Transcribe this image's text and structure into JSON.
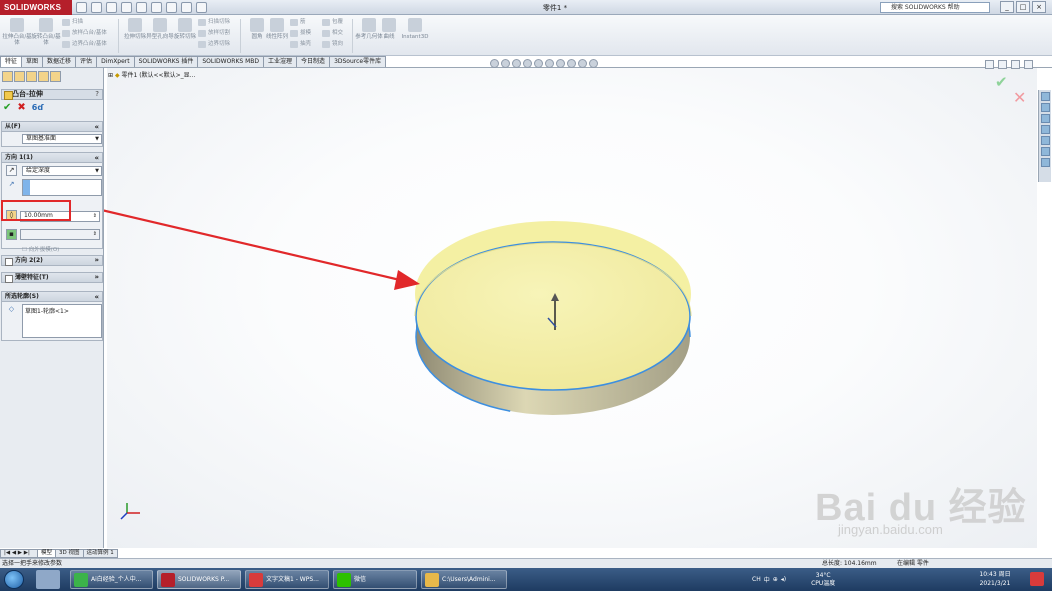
{
  "window": {
    "app_logo": "SOLIDWORKS",
    "doc_title": "零件1 *",
    "help_search": "搜索 SOLIDWORKS 帮助",
    "controls": [
      "_",
      "□",
      "×"
    ]
  },
  "command_manager": {
    "large_buttons": [
      "拉伸凸台/基体",
      "旋转凸台/基体",
      "拉伸切除",
      "异型孔向导",
      "旋转切除",
      "圆角",
      "线性阵列",
      "参考几何体",
      "曲线",
      "Instant3D"
    ],
    "small_rows": [
      "扫描",
      "放样凸台/基体",
      "边界凸台/基体",
      "扫描切除",
      "放样切割",
      "边界切除",
      "筋",
      "拔模",
      "抽壳",
      "包覆",
      "相交",
      "镜向"
    ]
  },
  "tabs": [
    "特征",
    "草图",
    "数据迁移",
    "评估",
    "DimXpert",
    "SOLIDWORKS 插件",
    "SOLIDWORKS MBD",
    "工业渲理",
    "今日制造",
    "3DSource零件库"
  ],
  "feature_tree": {
    "root": "零件1 (默认<<默认>_显..."
  },
  "property_manager": {
    "title": "凸台-拉伸",
    "help": "?",
    "ok_symbol": "✔",
    "cancel_symbol": "✖",
    "detail_symbol": "6ɗ",
    "from_group": {
      "label": "从(F)",
      "value": "草图基准面"
    },
    "direction1": {
      "label": "方向 1(1)",
      "end_condition": "给定深度",
      "depth": "10.00mm",
      "checkbox_label": "向外拔模(O)"
    },
    "direction2": {
      "label": "方向 2(2)"
    },
    "thin_feature": {
      "label": "薄壁特征(T)"
    },
    "selected_contours": {
      "label": "所选轮廓(S)",
      "item": "草图1-轮廓<1>"
    }
  },
  "bottom_tabs": [
    "模型",
    "3D 视图",
    "运动算例 1"
  ],
  "status": {
    "left": "选择一把手来修改参数",
    "length": "总长度: 104.16mm",
    "mode": "在编辑 零件"
  },
  "taskbar": {
    "tasks": [
      "Ai白经验_个人中...",
      "SOLIDWORKS P...",
      "文字文稿1 - WPS...",
      "微信",
      "C:\\Users\\Admini..."
    ],
    "temperature": "34°C",
    "cpu": "CPU温度",
    "time": "10:43 周日",
    "date": "2021/3/21"
  },
  "watermark": {
    "main": "Bai du 经验",
    "url": "jingyan.baidu.com"
  },
  "colors": {
    "accent_red": "#e1282a",
    "disk_top": "#f3ef9e",
    "disk_edge": "#3d8fe0",
    "brand": "#b51f2a"
  }
}
